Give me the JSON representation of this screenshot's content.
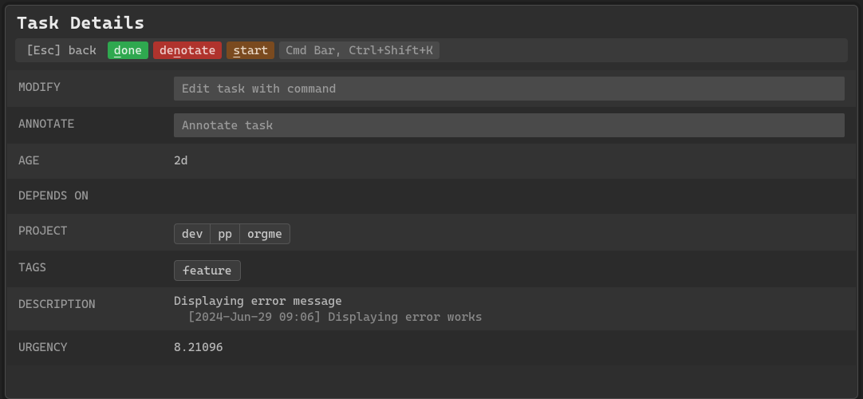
{
  "title": "Task Details",
  "toolbar": {
    "esc": "[Esc] back",
    "done_label": "one",
    "done_u": "d",
    "denotate_pre": "de",
    "denotate_u": "n",
    "denotate_post": "otate",
    "start_u": "s",
    "start_post": "tart",
    "cmdbar": "Cmd Bar, Ctrl+Shift+K"
  },
  "fields": {
    "modify_label": "MODIFY",
    "modify_placeholder": "Edit task with command",
    "annotate_label": "ANNOTATE",
    "annotate_placeholder": "Annotate task",
    "age_label": "AGE",
    "age_value": "2d",
    "depends_label": "DEPENDS ON",
    "depends_value": "",
    "project_label": "PROJECT",
    "project_path": [
      "dev",
      "pp",
      "orgme"
    ],
    "tags_label": "TAGS",
    "tags": [
      "feature"
    ],
    "description_label": "DESCRIPTION",
    "description_text": "Displaying error message",
    "description_annotation": "  [2024-Jun-29 09:06] Displaying error works",
    "urgency_label": "URGENCY",
    "urgency_value": "8.21096"
  }
}
